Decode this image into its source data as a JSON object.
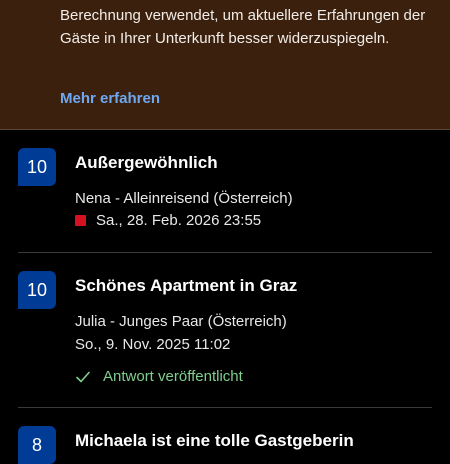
{
  "notice": {
    "text": "Berechnung verwendet, um aktuellere Erfahrungen der Gäste in Ihrer Unterkunft besser widerzuspiegeln.",
    "link": "Mehr erfahren"
  },
  "reviews": [
    {
      "score": "10",
      "title": "Außergewöhnlich",
      "guest": "Nena - Alleinreisend (Österreich)",
      "date": "Sa., 28. Feb. 2026 23:55"
    },
    {
      "score": "10",
      "title": "Schönes Apartment in Graz",
      "guest": "Julia - Junges Paar (Österreich)",
      "date": "So., 9. Nov. 2025 11:02",
      "response": "Antwort veröffentlicht"
    },
    {
      "score": "8",
      "title": "Michaela ist eine tolle Gastgeberin"
    }
  ],
  "colors": {
    "notice_bg": "#3b200e",
    "score_bg": "#003b95",
    "link": "#6ea8f0",
    "response": "#7fcf8e",
    "new_flag": "#d4111e"
  }
}
